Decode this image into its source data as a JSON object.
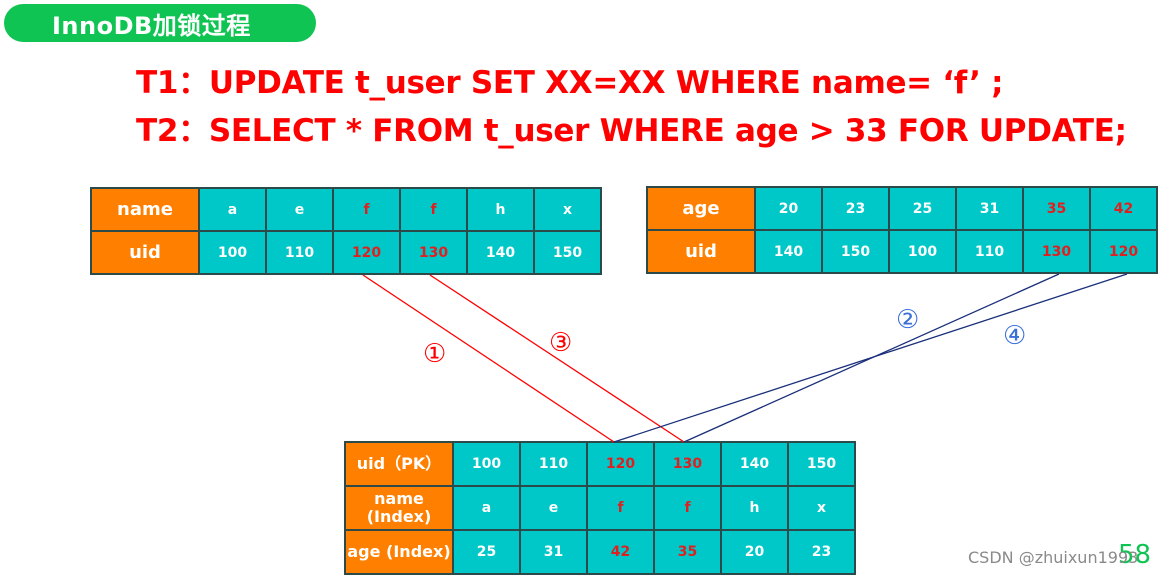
{
  "title_badge": "InnoDB加锁过程",
  "statements": {
    "t1": "T1：UPDATE t_user SET XX=XX WHERE name= ‘f’ ;",
    "t2": "T2：SELECT * FROM t_user WHERE age > 33 FOR UPDATE;"
  },
  "colors": {
    "badge": "#10c453",
    "sql_text": "#ff0000",
    "header_cell": "#ff8000",
    "data_cell": "#00c8c8",
    "highlight_text": "#e02020",
    "t1_lines": "#ff0000",
    "t2_lines": "#1a2f7a",
    "t2_labels": "#3a6fd8"
  },
  "name_index": {
    "rows": [
      {
        "header": "name",
        "cells": [
          "a",
          "e",
          "f",
          "f",
          "h",
          "x"
        ]
      },
      {
        "header": "uid",
        "cells": [
          "100",
          "110",
          "120",
          "130",
          "140",
          "150"
        ]
      }
    ],
    "highlighted_columns": [
      2,
      3
    ]
  },
  "age_index": {
    "rows": [
      {
        "header": "age",
        "cells": [
          "20",
          "23",
          "25",
          "31",
          "35",
          "42"
        ]
      },
      {
        "header": "uid",
        "cells": [
          "140",
          "150",
          "100",
          "110",
          "130",
          "120"
        ]
      }
    ],
    "highlighted_columns": [
      4,
      5
    ]
  },
  "primary_index": {
    "rows": [
      {
        "header": "uid（PK）",
        "cells": [
          "100",
          "110",
          "120",
          "130",
          "140",
          "150"
        ]
      },
      {
        "header": "name (Index)",
        "cells": [
          "a",
          "e",
          "f",
          "f",
          "h",
          "x"
        ]
      },
      {
        "header": "age (Index)",
        "cells": [
          "25",
          "31",
          "42",
          "35",
          "20",
          "23"
        ]
      }
    ],
    "highlighted_columns": [
      2,
      3
    ]
  },
  "links": [
    {
      "label": "①",
      "transaction": "T1",
      "from": "name_index uid 120",
      "to": "primary uid 120"
    },
    {
      "label": "②",
      "transaction": "T2",
      "from": "age_index uid 130",
      "to": "primary uid 130"
    },
    {
      "label": "③",
      "transaction": "T1",
      "from": "name_index uid 130",
      "to": "primary uid 130"
    },
    {
      "label": "④",
      "transaction": "T2",
      "from": "age_index uid 120",
      "to": "primary uid 120"
    }
  ],
  "watermark": "CSDN @zhuixun1993",
  "page_number": "58"
}
